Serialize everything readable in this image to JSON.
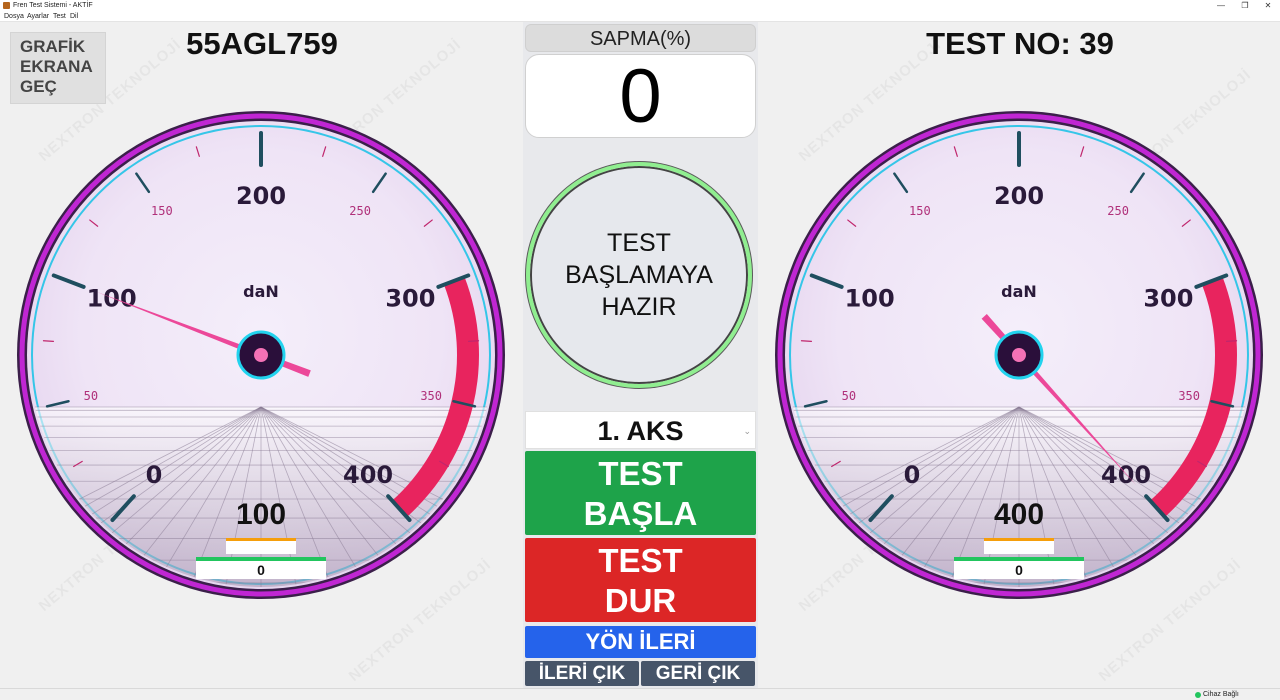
{
  "window": {
    "title": "Fren Test Sistemi - AKTİF",
    "minimize": "—",
    "maximize": "❐",
    "close": "✕"
  },
  "menu": [
    "Dosya",
    "Ayarlar",
    "Test",
    "Dil"
  ],
  "watermark": "NEXTRON TEKNOLOJİ",
  "graph_button": "GRAFİK\nEKRANA\nGEÇ",
  "plate": "55AGL759",
  "test_no": "TEST NO: 39",
  "sapma": {
    "label": "SAPMA(%)",
    "value": "0"
  },
  "status": "TEST\nBAŞLAMAYA\nHAZIR",
  "axle_select": {
    "value": "1. AKS"
  },
  "buttons": {
    "start": "TEST\nBAŞLA",
    "stop": "TEST\nDUR",
    "direction": "YÖN İLERİ",
    "forward_exit": "İLERİ ÇIK",
    "back_exit": "GERİ ÇIK"
  },
  "gauge_unit": "daN",
  "gauge_major_ticks": [
    "0",
    "100",
    "200",
    "300",
    "400"
  ],
  "gauge_minor_ticks": [
    "50",
    "150",
    "250",
    "350"
  ],
  "gauge_min": 0,
  "gauge_max": 400,
  "gauge_redzone_from": 300,
  "gauges": [
    {
      "name": "left",
      "value": 100,
      "display": "100",
      "bottom": "0"
    },
    {
      "name": "right",
      "value": 400,
      "display": "400",
      "bottom": "0"
    }
  ],
  "colors": {
    "rim": "#c026d3",
    "needle": "#ec4899",
    "redzone": "#e8245e",
    "tick": "#1f4e5f",
    "label": "#2a1a3a"
  },
  "statusbar": {
    "device": "Cihaz Bağlı"
  }
}
